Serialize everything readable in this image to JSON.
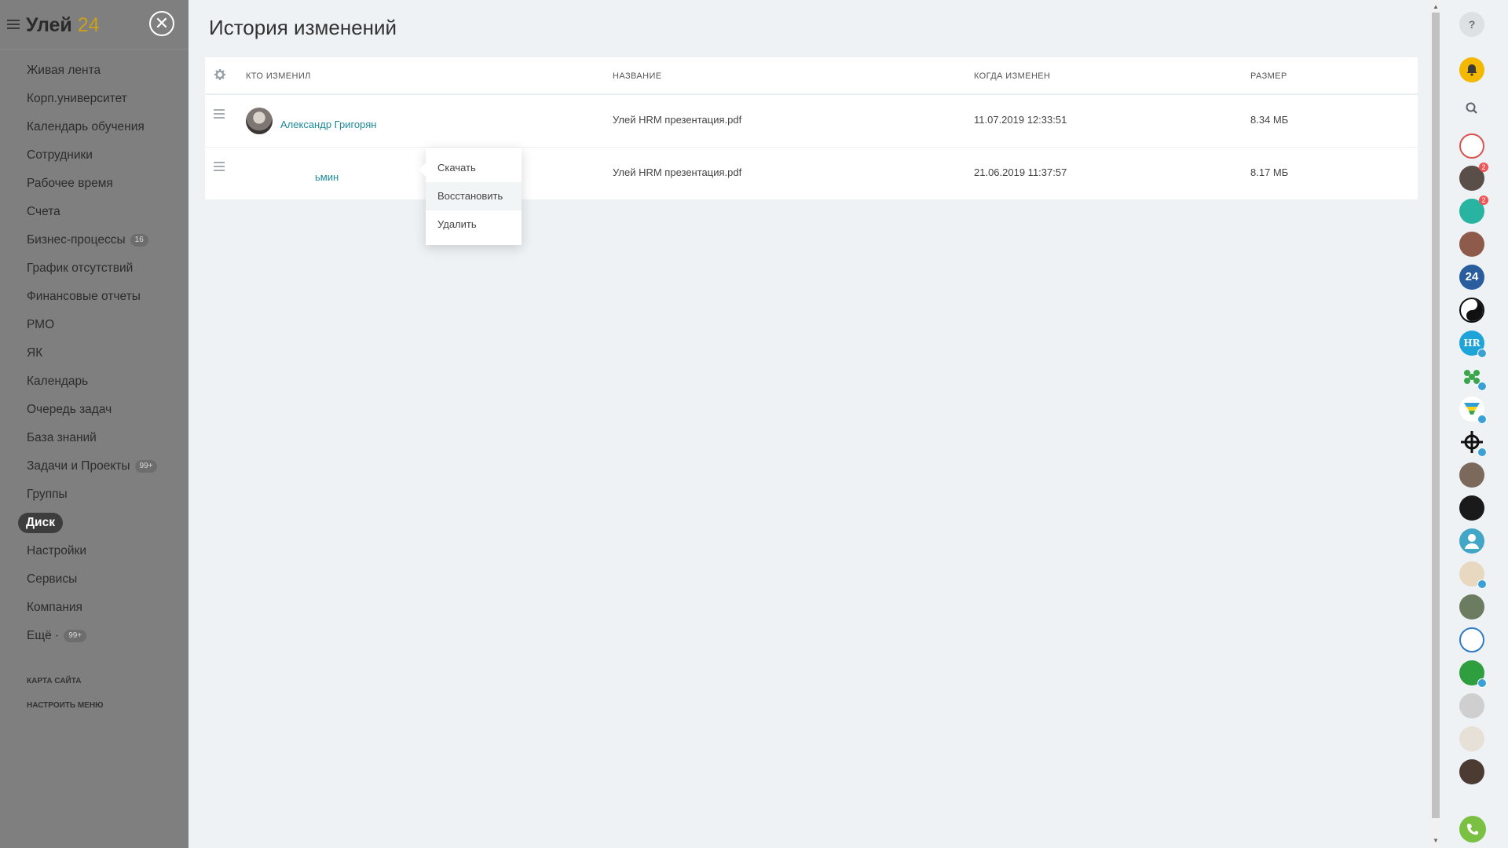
{
  "sidebar": {
    "logo_name": "Улей",
    "logo_number": "24",
    "close_glyph": "✕",
    "items": [
      {
        "label": "Живая лента"
      },
      {
        "label": "Корп.университет"
      },
      {
        "label": "Календарь обучения"
      },
      {
        "label": "Сотрудники"
      },
      {
        "label": "Рабочее время"
      },
      {
        "label": "Счета"
      },
      {
        "label": "Бизнес-процессы",
        "badge": "16"
      },
      {
        "label": "График отсутствий"
      },
      {
        "label": "Финансовые отчеты"
      },
      {
        "label": "РМО"
      },
      {
        "label": "ЯК"
      },
      {
        "label": "Календарь"
      },
      {
        "label": "Очередь задач"
      },
      {
        "label": "База знаний"
      },
      {
        "label": "Задачи и Проекты",
        "badge": "99+"
      },
      {
        "label": "Группы"
      },
      {
        "label": "Диск",
        "active": true
      },
      {
        "label": "Настройки"
      },
      {
        "label": "Сервисы"
      },
      {
        "label": "Компания"
      },
      {
        "label": "Ещё ·",
        "badge": "99+"
      }
    ],
    "links": {
      "sitemap": "КАРТА САЙТА",
      "configure_menu": "НАСТРОИТЬ МЕНЮ"
    }
  },
  "main": {
    "title": "История изменений",
    "columns": {
      "who": "КТО ИЗМЕНИЛ",
      "name": "НАЗВАНИЕ",
      "when": "КОГДА ИЗМЕНЕН",
      "size": "РАЗМЕР"
    },
    "rows": [
      {
        "user": "Александр Григорян",
        "file": "Улей HRM презентация.pdf",
        "date": "11.07.2019 12:33:51",
        "size": "8.34 МБ"
      },
      {
        "user": "ьмин",
        "file": "Улей HRM презентация.pdf",
        "date": "21.06.2019 11:37:57",
        "size": "8.17 МБ"
      }
    ]
  },
  "context_menu": {
    "download": "Скачать",
    "restore": "Восстановить",
    "delete": "Удалить"
  },
  "rightbar": {
    "help": "?",
    "item_24": "24",
    "item_hr": "HR",
    "counters": [
      "2",
      "2"
    ]
  },
  "colors": {
    "link": "#1d8a9b",
    "sidebar_dim": "#7f7f7f",
    "logo_accent": "#c9a21a",
    "notification": "#f5b800",
    "call": "#7ac143"
  }
}
